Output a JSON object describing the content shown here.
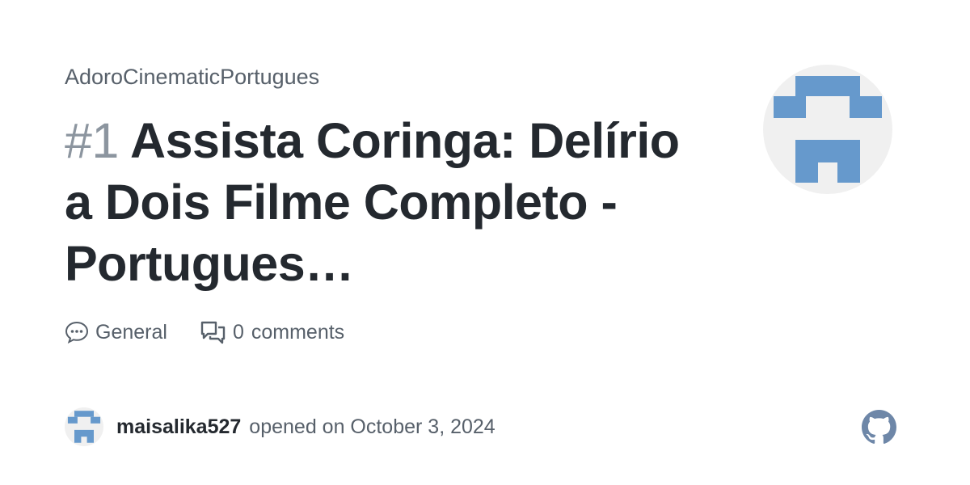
{
  "repo": {
    "name": "AdoroCinematicPortugues"
  },
  "issue": {
    "number": "#1",
    "title": "Assista Coringa: Delírio a Dois Filme Completo - Portugues…"
  },
  "meta": {
    "category": "General",
    "comments_count": "0",
    "comments_label": "comments"
  },
  "author": {
    "username": "maisalika527",
    "opened_text": "opened on October 3, 2024"
  },
  "colors": {
    "identicon": "#6699cc",
    "title": "#24292f",
    "muted": "#57606a"
  },
  "icons": [
    "speech-balloon-icon",
    "comments-icon",
    "github-icon"
  ]
}
